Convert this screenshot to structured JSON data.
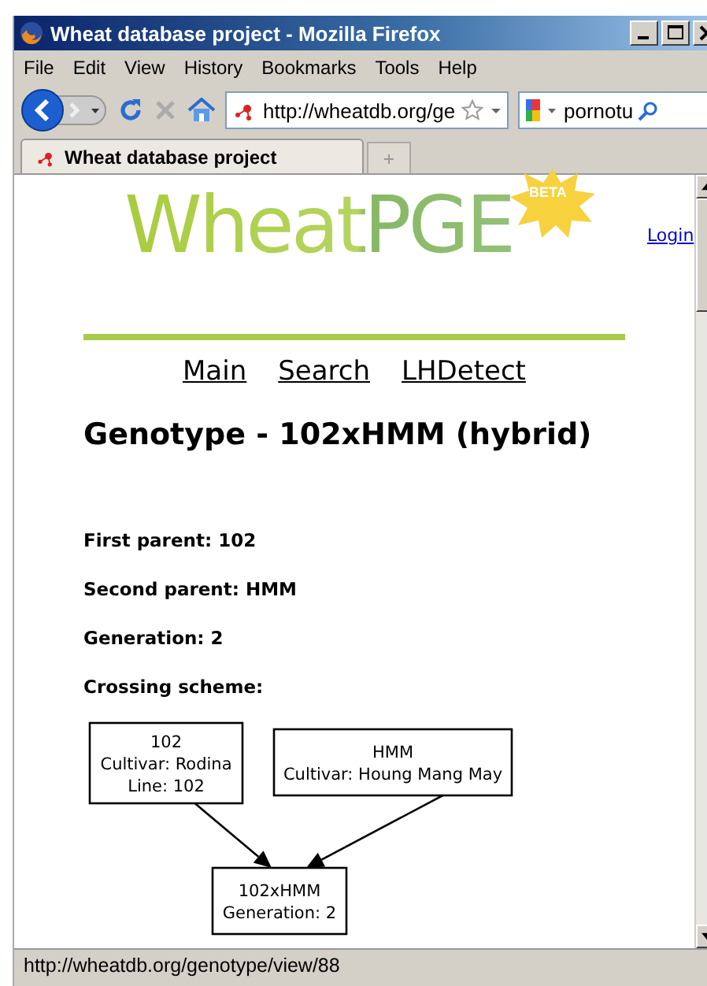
{
  "window": {
    "title": "Wheat database project - Mozilla Firefox"
  },
  "menu": [
    "File",
    "Edit",
    "View",
    "History",
    "Bookmarks",
    "Tools",
    "Help"
  ],
  "toolbar": {
    "url": "http://wheatdb.org/ge",
    "search": "pornotu"
  },
  "tabs": [
    {
      "label": "Wheat database project",
      "selected": true
    }
  ],
  "page": {
    "logo": "WheatPGE",
    "badge": "BETA",
    "login": "Login",
    "nav": [
      "Main",
      "Search",
      "LHDetect"
    ],
    "heading": "Genotype - 102xHMM (hybrid)",
    "fields": [
      "First parent: 102",
      "Second parent: HMM",
      "Generation: 2",
      "Crossing scheme:"
    ],
    "diagram": {
      "nodes": [
        {
          "kind": "parent",
          "lines": [
            "102",
            "Cultivar: Rodina",
            "Line: 102"
          ]
        },
        {
          "kind": "parent",
          "lines": [
            "HMM",
            "Cultivar: Houng Mang May"
          ]
        },
        {
          "kind": "child",
          "lines": [
            "102xHMM",
            "Generation: 2"
          ]
        }
      ]
    }
  },
  "status_bar": "http://wheatdb.org/genotype/view/88"
}
